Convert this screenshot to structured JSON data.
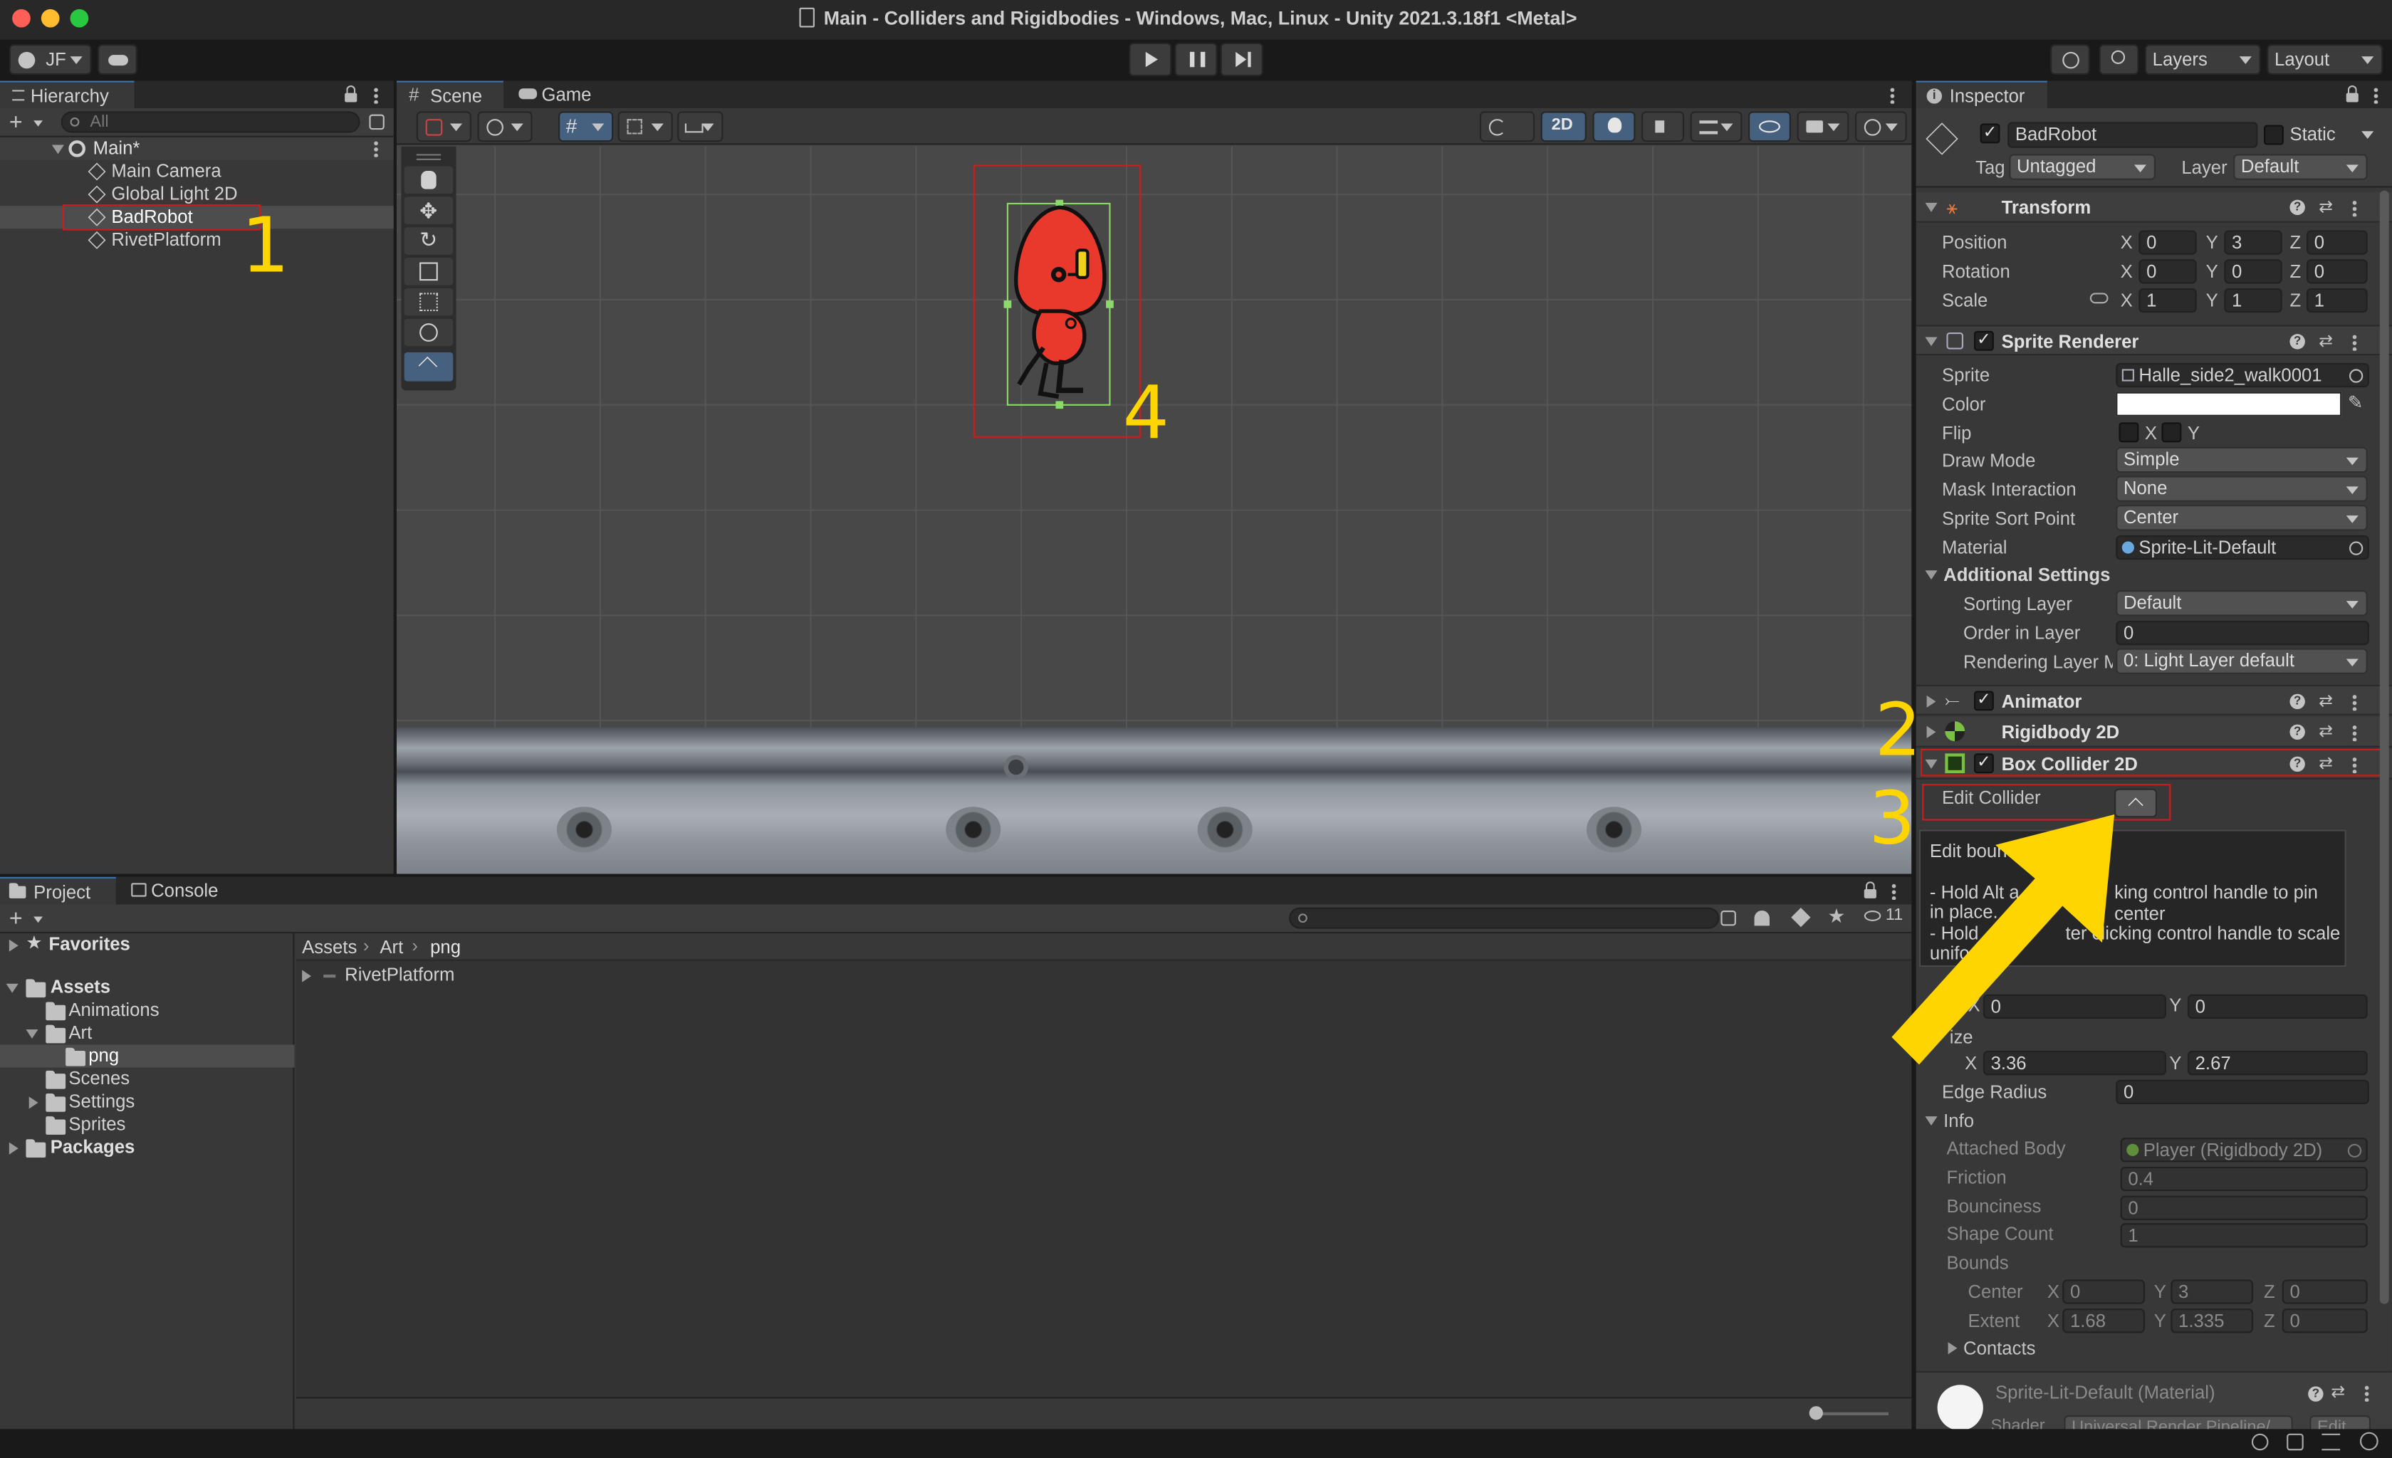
{
  "window": {
    "title": "Main - Colliders and Rigidbodies - Windows, Mac, Linux - Unity 2021.3.18f1 <Metal>",
    "account": "JF",
    "layers_label": "Layers",
    "layout_label": "Layout"
  },
  "hierarchy": {
    "tab": "Hierarchy",
    "search_placeholder": "All",
    "scene": "Main*",
    "items": [
      "Main Camera",
      "Global Light 2D",
      "BadRobot",
      "RivetPlatform"
    ]
  },
  "scene_view": {
    "tabs": [
      "Scene",
      "Game"
    ],
    "mode_2d": "2D"
  },
  "project": {
    "tabs": [
      "Project",
      "Console"
    ],
    "favorites": "Favorites",
    "assets": "Assets",
    "tree": [
      "Animations",
      "Art",
      "png",
      "Scenes",
      "Settings",
      "Sprites"
    ],
    "packages": "Packages",
    "breadcrumb": [
      "Assets",
      "Art",
      "png"
    ],
    "files": [
      "RivetPlatform"
    ],
    "hidden_count": "11"
  },
  "inspector": {
    "tab": "Inspector",
    "object_name": "BadRobot",
    "static_label": "Static",
    "tag_label": "Tag",
    "tag_value": "Untagged",
    "layer_label": "Layer",
    "layer_value": "Default",
    "transform": {
      "title": "Transform",
      "position_label": "Position",
      "position": {
        "x": "0",
        "y": "3",
        "z": "0"
      },
      "rotation_label": "Rotation",
      "rotation": {
        "x": "0",
        "y": "0",
        "z": "0"
      },
      "scale_label": "Scale",
      "scale": {
        "x": "1",
        "y": "1",
        "z": "1"
      }
    },
    "sprite_renderer": {
      "title": "Sprite Renderer",
      "sprite_label": "Sprite",
      "sprite": "Halle_side2_walk0001",
      "color_label": "Color",
      "color_value": "#ffffff",
      "flip_label": "Flip",
      "flip_x": "X",
      "flip_y": "Y",
      "draw_mode_label": "Draw Mode",
      "draw_mode": "Simple",
      "mask_label": "Mask Interaction",
      "mask": "None",
      "sort_point_label": "Sprite Sort Point",
      "sort_point": "Center",
      "material_label": "Material",
      "material": "Sprite-Lit-Default",
      "additional": "Additional Settings",
      "sorting_layer_label": "Sorting Layer",
      "sorting_layer": "Default",
      "order_label": "Order in Layer",
      "order": "0",
      "render_mask_label": "Rendering Layer M",
      "render_mask": "0: Light Layer default"
    },
    "animator": "Animator",
    "rigidbody": "Rigidbody 2D",
    "box_collider": {
      "title": "Box Collider 2D",
      "edit_label": "Edit Collider",
      "tooltip": [
        "Edit bounding",
        "- Hold Alt a",
        "king control handle to pin center",
        "in place.",
        "- Hold",
        "ter clicking control handle to scale",
        "unifo"
      ],
      "offset": {
        "x": "0",
        "y": "0"
      },
      "size_label": "ize",
      "size": {
        "x": "3.36",
        "y": "2.67"
      },
      "edge_label": "Edge Radius",
      "edge": "0",
      "info": "Info",
      "attached_label": "Attached Body",
      "attached": "Player (Rigidbody 2D)",
      "friction_label": "Friction",
      "friction": "0.4",
      "bounciness_label": "Bounciness",
      "bounciness": "0",
      "shape_label": "Shape Count",
      "shape": "1",
      "bounds_label": "Bounds",
      "center_label": "Center",
      "center": {
        "x": "0",
        "y": "3",
        "z": "0"
      },
      "extent_label": "Extent",
      "extent": {
        "x": "1.68",
        "y": "1.335",
        "z": "0"
      },
      "contacts": "Contacts"
    },
    "material_footer": "Sprite-Lit-Default (Material)",
    "shader_label": "Shader",
    "shader_value": "Universal Render Pipeline/",
    "edit_label": "Edit"
  },
  "annotations": [
    "1",
    "2",
    "3",
    "4"
  ],
  "colors": {
    "accent": "#3a72b0",
    "annotation": "#ffd500",
    "highlight_box": "#d21a1a",
    "robot": "#e8392c"
  }
}
